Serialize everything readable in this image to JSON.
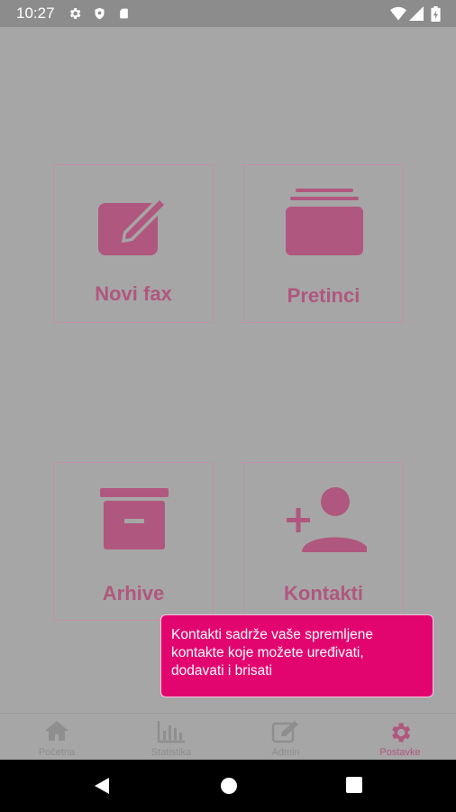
{
  "status_bar": {
    "time": "10:27",
    "left_icons": [
      "gear-icon",
      "shield-icon",
      "sd-card-icon"
    ],
    "right_icons": [
      "wifi-icon",
      "signal-icon",
      "battery-icon"
    ]
  },
  "tiles": [
    {
      "id": "new-fax",
      "label": "Novi fax",
      "icon": "edit-icon"
    },
    {
      "id": "inboxes",
      "label": "Pretinci",
      "icon": "inbox-stack-icon"
    },
    {
      "id": "archives",
      "label": "Arhive",
      "icon": "archive-box-icon"
    },
    {
      "id": "contacts",
      "label": "Kontakti",
      "icon": "add-person-icon"
    }
  ],
  "tooltip": {
    "line1": "Kontakti sadrže vaše spremljene",
    "line2": "kontakte koje možete uređivati,",
    "line3": "dodavati i brisati"
  },
  "bottom_nav": {
    "items": [
      {
        "label": "Početna",
        "icon": "home-icon"
      },
      {
        "label": "Statistika",
        "icon": "bar-chart-icon"
      },
      {
        "label": "Admin",
        "icon": "edit-icon"
      },
      {
        "label": "Postavke",
        "icon": "gear-icon",
        "active": true
      }
    ]
  },
  "colors": {
    "accent": "#e3056f",
    "tile_icon": "#b0577f",
    "overlay_bg": "#a6a6a6"
  }
}
